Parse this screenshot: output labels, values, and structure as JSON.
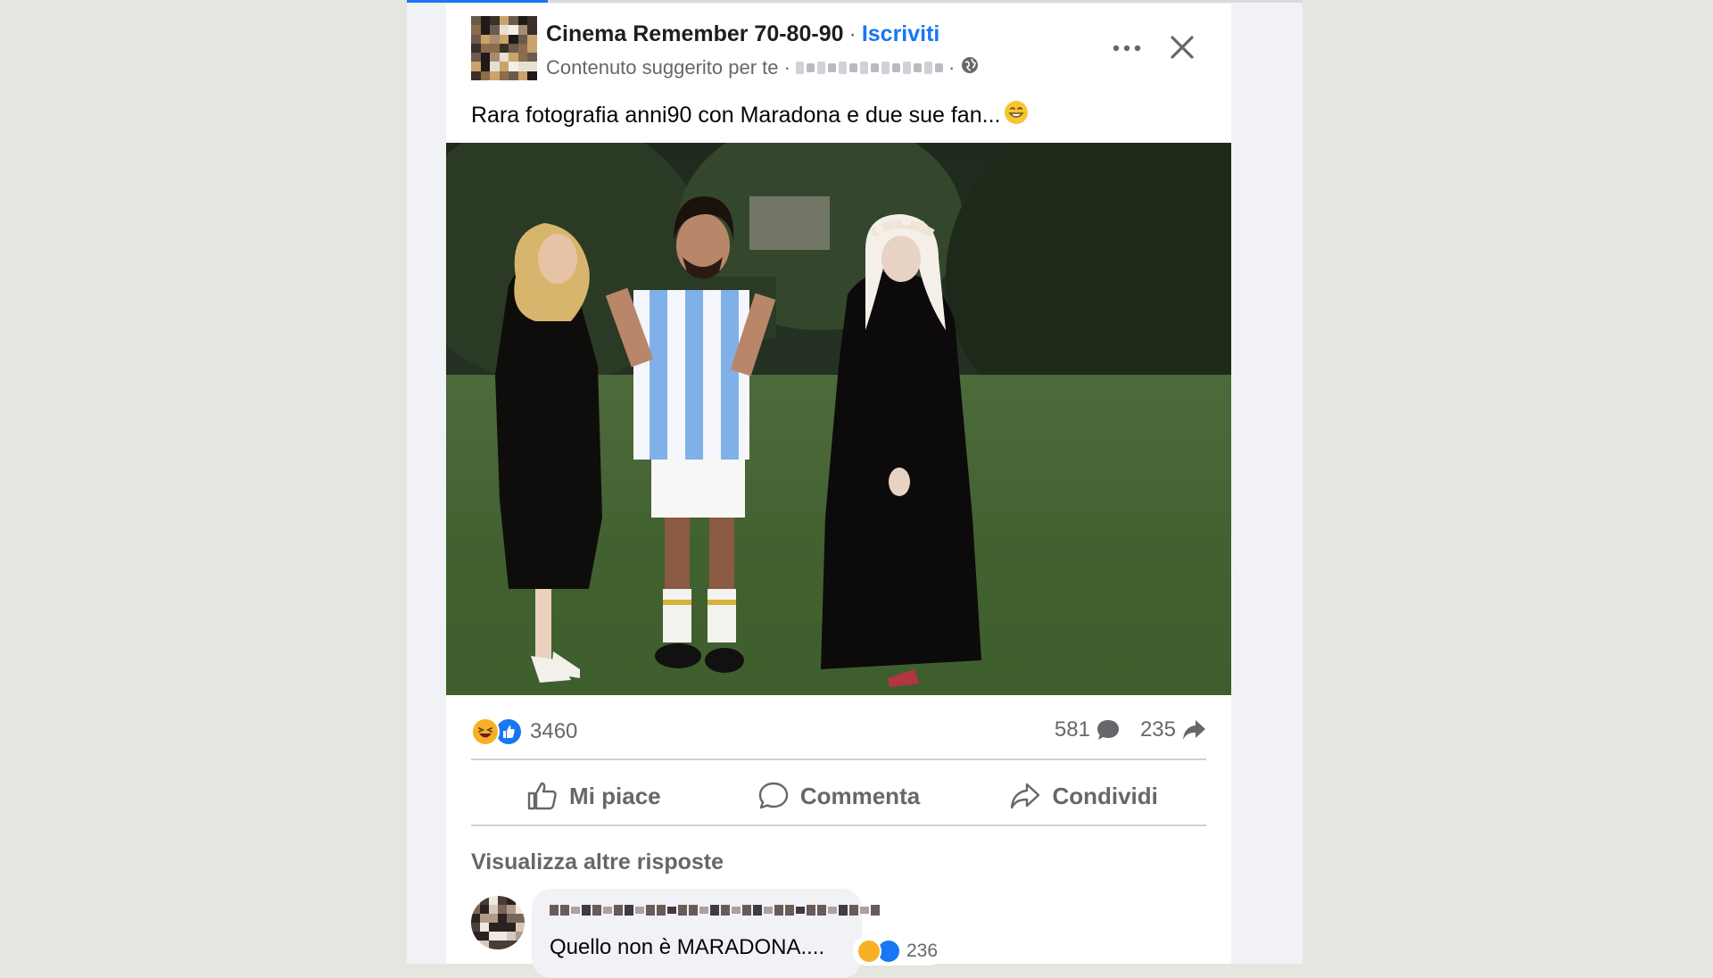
{
  "post": {
    "page_name": "Cinema Remember 70-80-90",
    "separator": "·",
    "subscribe_label": "Iscriviti",
    "meta_text": "Contenuto suggerito per te ·",
    "meta_trailing": "·",
    "caption": "Rara fotografia  anni90 con Maradona e due sue fan...",
    "caption_emoji": "😁",
    "more_icon": "more-horizontal-icon",
    "close_icon": "close-icon"
  },
  "engagement": {
    "reaction_count": "3460",
    "comment_count": "581",
    "share_count": "235",
    "reaction_types": [
      "haha",
      "like"
    ]
  },
  "actions": [
    {
      "label": "Mi piace",
      "icon": "thumbs-up-icon"
    },
    {
      "label": "Commenta",
      "icon": "comment-icon"
    },
    {
      "label": "Condividi",
      "icon": "share-icon"
    }
  ],
  "comments": {
    "more_replies_label": "Visualizza altre risposte",
    "items": [
      {
        "text": "Quello non è MARADONA....",
        "reaction_count": "236"
      }
    ]
  },
  "colors": {
    "accent": "#1877f2",
    "haha": "#f7b125",
    "muted_text": "#65676b",
    "background": "#e6e6e1"
  }
}
